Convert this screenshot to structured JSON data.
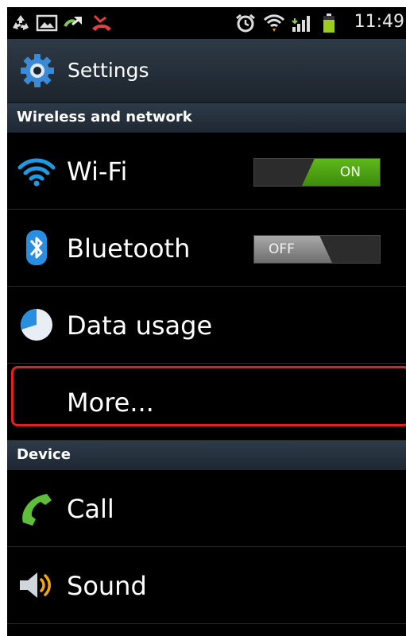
{
  "status_bar": {
    "icons": [
      "recycle-icon",
      "image-icon",
      "missed-call-arrow-icon",
      "missed-call-icon",
      "alarm-icon",
      "wifi-signal-icon",
      "cell-signal-icon",
      "battery-icon"
    ],
    "time": "11:49"
  },
  "header": {
    "title": "Settings",
    "icon": "gear-icon"
  },
  "sections": {
    "wireless": "Wireless and network",
    "device": "Device"
  },
  "rows": {
    "wifi": {
      "label": "Wi-Fi",
      "icon": "wifi-icon",
      "toggle": "ON"
    },
    "bluetooth": {
      "label": "Bluetooth",
      "icon": "bluetooth-icon",
      "toggle": "OFF"
    },
    "data_usage": {
      "label": "Data usage",
      "icon": "pie-chart-icon"
    },
    "more": {
      "label": "More..."
    },
    "call": {
      "label": "Call",
      "icon": "phone-icon"
    },
    "sound": {
      "label": "Sound",
      "icon": "speaker-icon"
    }
  },
  "colors": {
    "toggle_on": "#4ca312",
    "highlight": "#e02020",
    "section_bg": "#26313d"
  }
}
